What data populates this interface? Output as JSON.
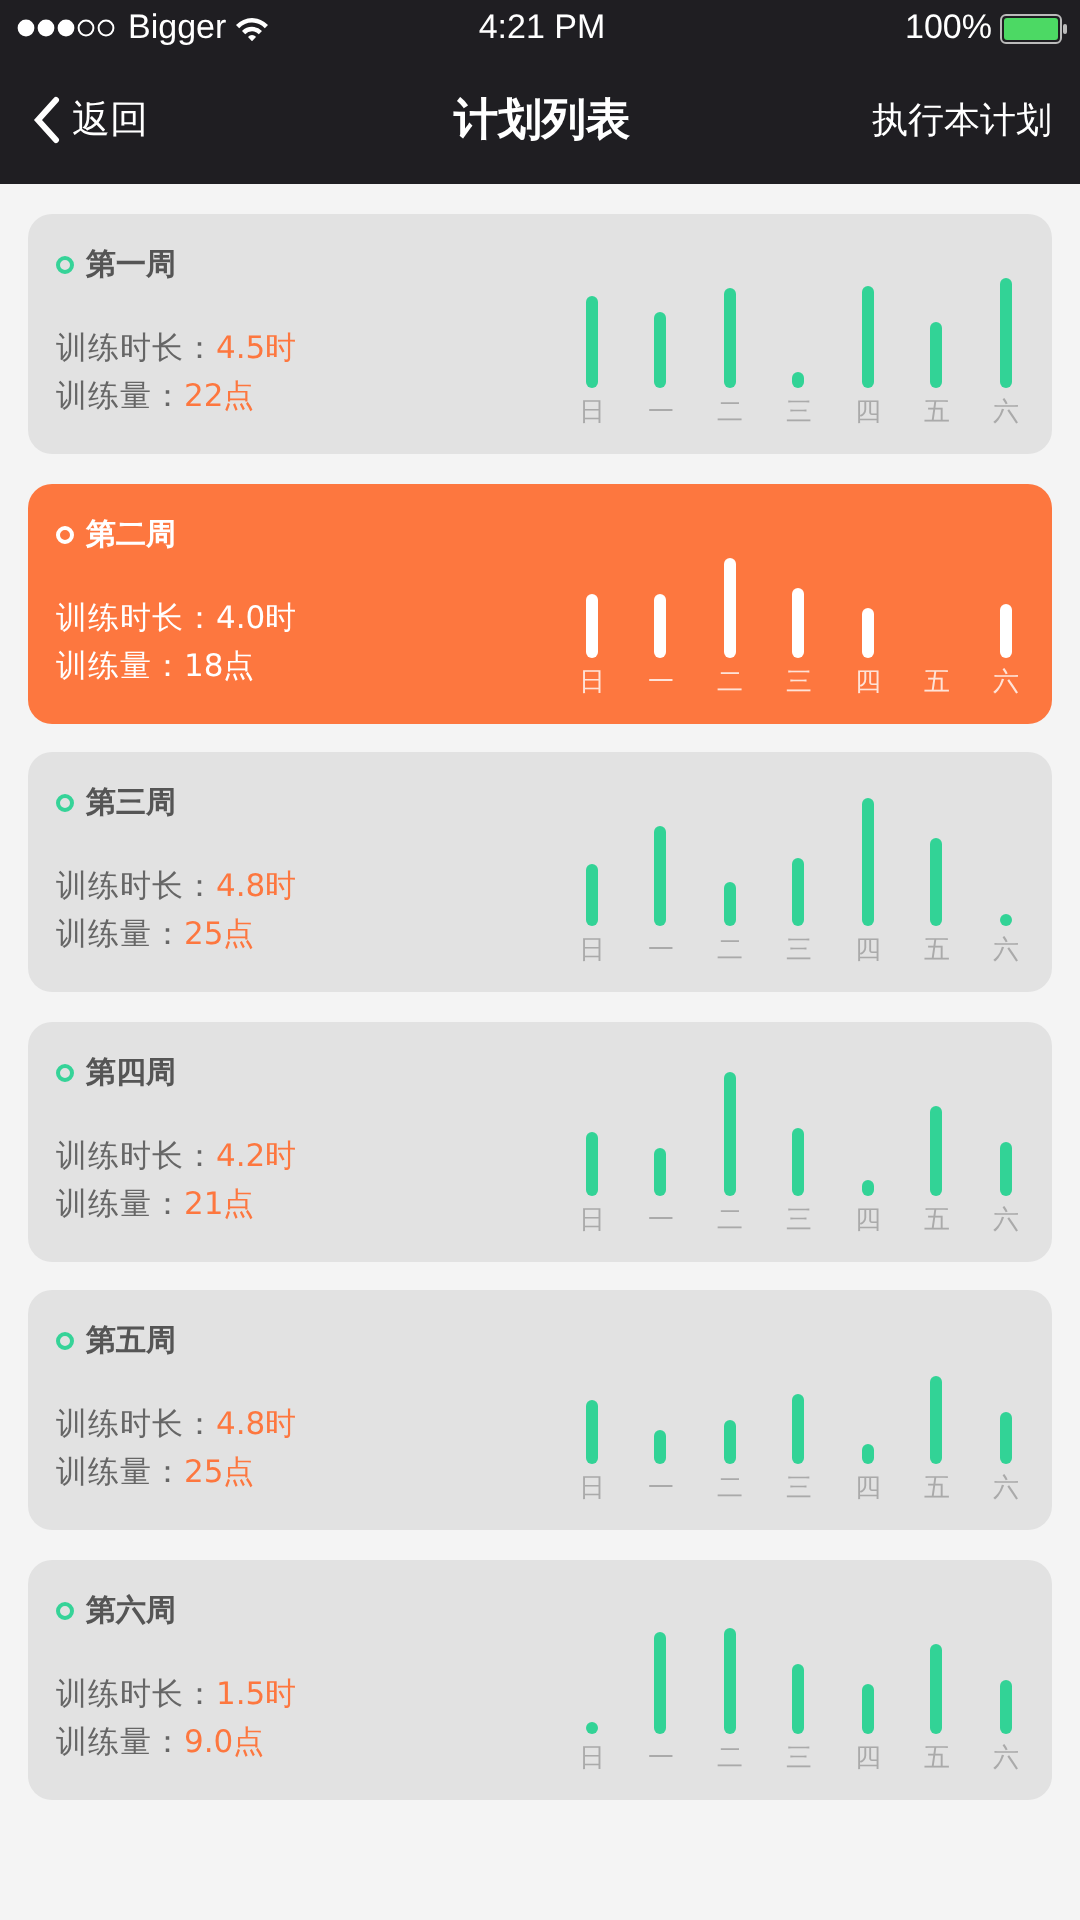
{
  "status_bar": {
    "carrier": "Bigger",
    "time": "4:21 PM",
    "battery": "100%"
  },
  "nav": {
    "back": "返回",
    "title": "计划列表",
    "action": "执行本计划"
  },
  "weeks": [
    {
      "title": "第一周",
      "selected": false,
      "duration_label": "训练时长：",
      "duration": "4.5时",
      "volume_label": "训练量：",
      "volume": "22点",
      "days": [
        "日",
        "一",
        "二",
        "三",
        "四",
        "五",
        "六"
      ]
    },
    {
      "title": "第二周",
      "selected": true,
      "duration_label": "训练时长：",
      "duration": "4.0时",
      "volume_label": "训练量：",
      "volume": "18点",
      "days": [
        "日",
        "一",
        "二",
        "三",
        "四",
        "五",
        "六"
      ]
    },
    {
      "title": "第三周",
      "selected": false,
      "duration_label": "训练时长：",
      "duration": "4.8时",
      "volume_label": "训练量：",
      "volume": "25点",
      "days": [
        "日",
        "一",
        "二",
        "三",
        "四",
        "五",
        "六"
      ]
    },
    {
      "title": "第四周",
      "selected": false,
      "duration_label": "训练时长：",
      "duration": "4.2时",
      "volume_label": "训练量：",
      "volume": "21点",
      "days": [
        "日",
        "一",
        "二",
        "三",
        "四",
        "五",
        "六"
      ]
    },
    {
      "title": "第五周",
      "selected": false,
      "duration_label": "训练时长：",
      "duration": "4.8时",
      "volume_label": "训练量：",
      "volume": "25点",
      "days": [
        "日",
        "一",
        "二",
        "三",
        "四",
        "五",
        "六"
      ]
    },
    {
      "title": "第六周",
      "selected": false,
      "duration_label": "训练时长：",
      "duration": "1.5时",
      "volume_label": "训练量：",
      "volume": "9.0点",
      "days": [
        "日",
        "一",
        "二",
        "三",
        "四",
        "五",
        "六"
      ]
    }
  ]
}
